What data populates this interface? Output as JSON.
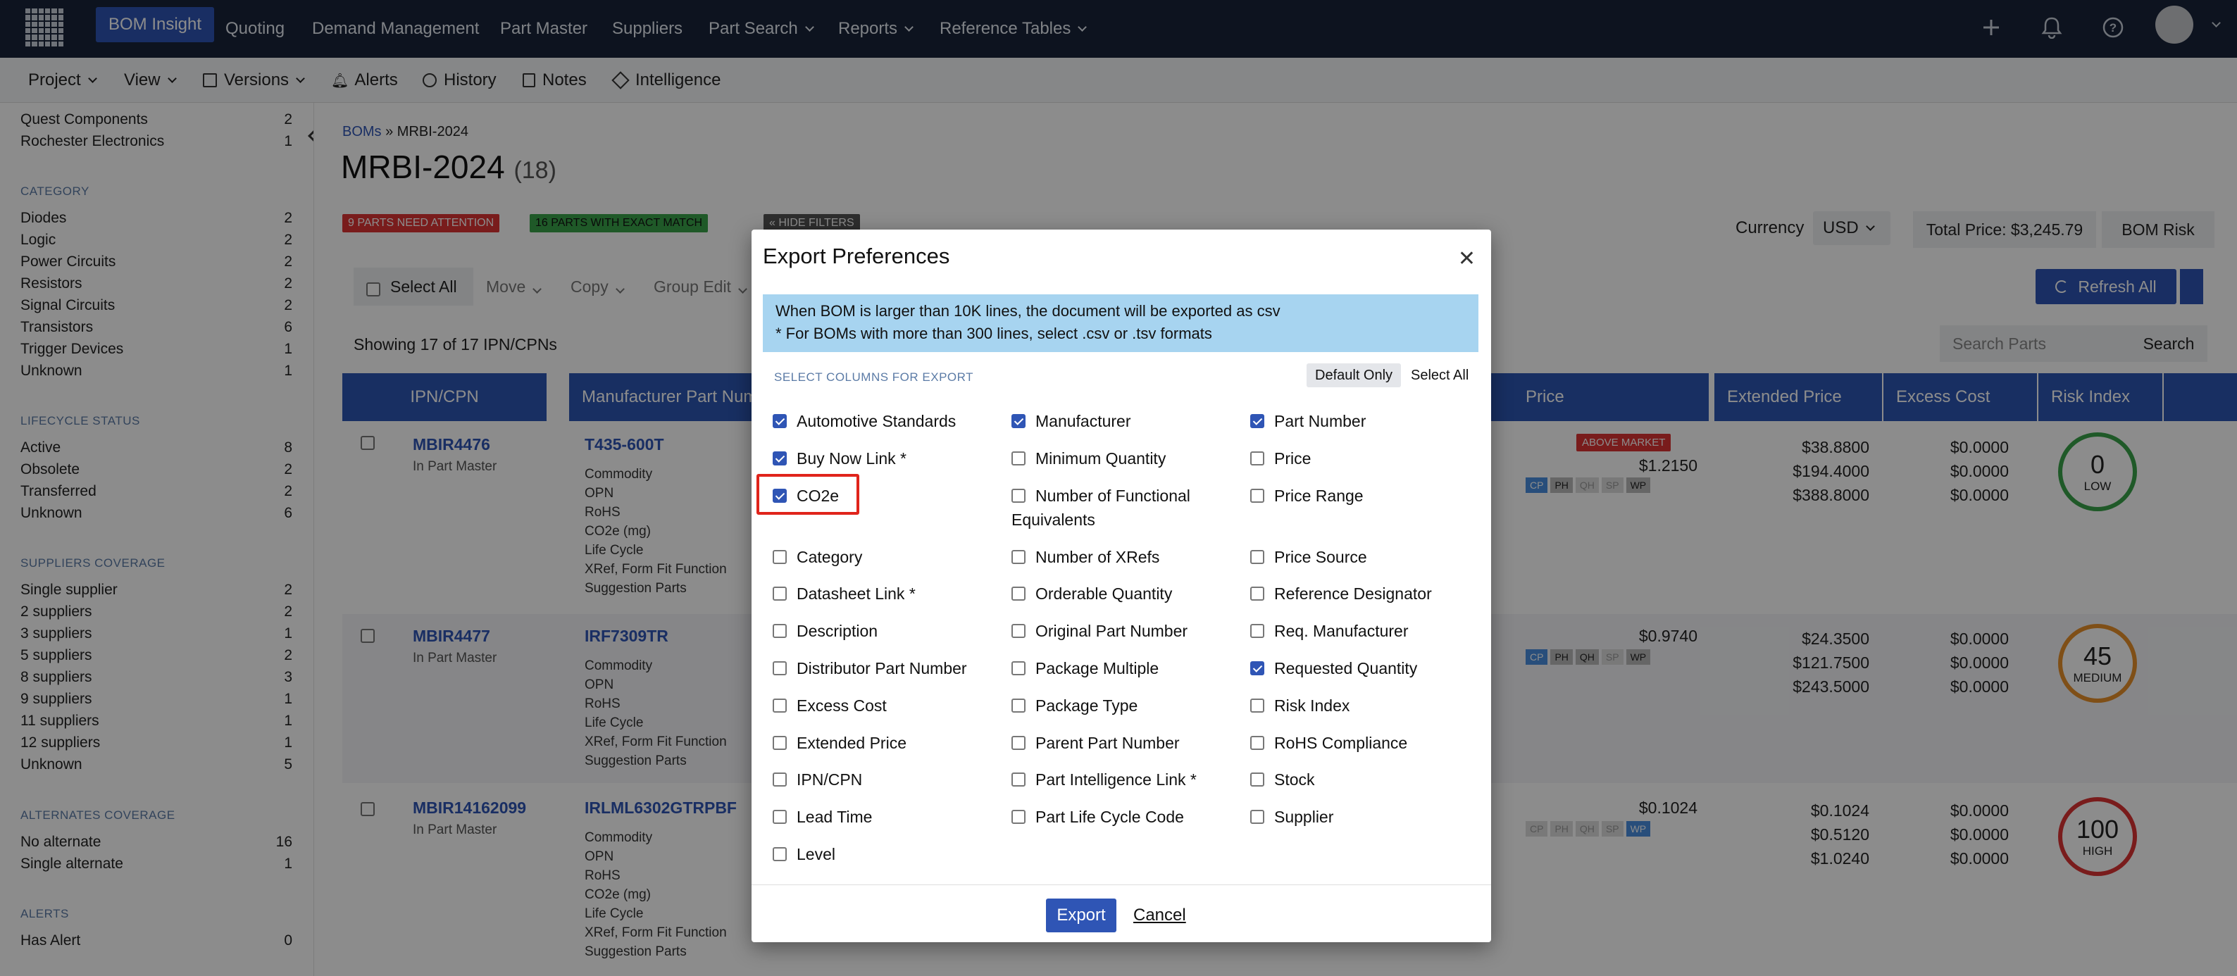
{
  "topnav": {
    "items": [
      "BOM Insight",
      "Quoting",
      "Demand Management",
      "Part Master",
      "Suppliers",
      "Part Search",
      "Reports",
      "Reference Tables"
    ],
    "icons": [
      "plus-icon",
      "bell-icon",
      "help-icon",
      "avatar"
    ]
  },
  "subnav": {
    "items": [
      "Project",
      "View",
      "Versions",
      "Alerts",
      "History",
      "Notes",
      "Intelligence"
    ]
  },
  "sidebar": {
    "top_rows": [
      {
        "label": "Quest Components",
        "count": "2"
      },
      {
        "label": "Rochester Electronics",
        "count": "1"
      }
    ],
    "sections": [
      {
        "title": "CATEGORY",
        "rows": [
          {
            "label": "Diodes",
            "count": "2"
          },
          {
            "label": "Logic",
            "count": "2"
          },
          {
            "label": "Power Circuits",
            "count": "2"
          },
          {
            "label": "Resistors",
            "count": "2"
          },
          {
            "label": "Signal Circuits",
            "count": "2"
          },
          {
            "label": "Transistors",
            "count": "6"
          },
          {
            "label": "Trigger Devices",
            "count": "1"
          },
          {
            "label": "Unknown",
            "count": "1"
          }
        ]
      },
      {
        "title": "LIFECYCLE STATUS",
        "rows": [
          {
            "label": "Active",
            "count": "8"
          },
          {
            "label": "Obsolete",
            "count": "2"
          },
          {
            "label": "Transferred",
            "count": "2"
          },
          {
            "label": "Unknown",
            "count": "6"
          }
        ]
      },
      {
        "title": "SUPPLIERS COVERAGE",
        "rows": [
          {
            "label": "Single supplier",
            "count": "2"
          },
          {
            "label": "2 suppliers",
            "count": "2"
          },
          {
            "label": "3 suppliers",
            "count": "1"
          },
          {
            "label": "5 suppliers",
            "count": "2"
          },
          {
            "label": "8 suppliers",
            "count": "3"
          },
          {
            "label": "9 suppliers",
            "count": "1"
          },
          {
            "label": "11 suppliers",
            "count": "1"
          },
          {
            "label": "12 suppliers",
            "count": "1"
          },
          {
            "label": "Unknown",
            "count": "5"
          }
        ]
      },
      {
        "title": "ALTERNATES COVERAGE",
        "rows": [
          {
            "label": "No alternate",
            "count": "16"
          },
          {
            "label": "Single alternate",
            "count": "1"
          }
        ]
      },
      {
        "title": "ALERTS",
        "rows": [
          {
            "label": "Has Alert",
            "count": "0"
          }
        ]
      }
    ]
  },
  "main": {
    "breadcrumb_link": "BOMs",
    "breadcrumb_current": "» MRBI-2024",
    "title": "MRBI-2024",
    "count": "(18)",
    "badge_attention": "9 PARTS NEED ATTENTION",
    "badge_match": "16 PARTS WITH EXACT MATCH",
    "hide_filters": "« HIDE FILTERS",
    "currency_label": "Currency",
    "currency_value": "USD",
    "total_price": "Total Price: $3,245.79",
    "bom_risk": "BOM Risk",
    "select_all": "Select All",
    "move": "Move",
    "copy": "Copy",
    "group_edit": "Group Edit",
    "refresh_all": "Refresh All",
    "showing": "Showing 17 of 17 IPN/CPNs",
    "search_placeholder": "Search Parts",
    "search_button": "Search",
    "columns": [
      "IPN/CPN",
      "Manufacturer Part Num",
      "Price",
      "Extended Price",
      "Excess Cost",
      "Risk Index"
    ],
    "rows": [
      {
        "ipn": "MBIR4476",
        "status": "In Part Master",
        "mpn": "T435-600T",
        "labels": [
          "Commodity",
          "OPN",
          "RoHS",
          "CO2e (mg)",
          "Life Cycle",
          "XRef, Form Fit Function",
          "Suggestion Parts"
        ],
        "price_badge": "ABOVE MARKET",
        "price": "$1.2150",
        "ext": [
          "$38.8800",
          "$194.4000",
          "$388.8000"
        ],
        "excess": [
          "$0.0000",
          "$0.0000",
          "$0.0000"
        ],
        "risk": "0",
        "risk_label": "LOW",
        "risk_color": "#3aa34a"
      },
      {
        "ipn": "MBIR4477",
        "status": "In Part Master",
        "mpn": "IRF7309TR",
        "labels": [
          "Commodity",
          "OPN",
          "RoHS",
          "Life Cycle",
          "XRef, Form Fit Function",
          "Suggestion Parts"
        ],
        "price_badge": "",
        "price": "$0.9740",
        "ext": [
          "$24.3500",
          "$121.7500",
          "$243.5000"
        ],
        "excess": [
          "$0.0000",
          "$0.0000",
          "$0.0000"
        ],
        "risk": "45",
        "risk_label": "MEDIUM",
        "risk_color": "#e8902a"
      },
      {
        "ipn": "MBIR14162099",
        "status": "In Part Master",
        "mpn": "IRLML6302GTRPBF",
        "labels": [
          "Commodity",
          "OPN",
          "RoHS",
          "CO2e (mg)",
          "Life Cycle",
          "XRef, Form Fit Function",
          "Suggestion Parts"
        ],
        "price_badge": "",
        "price": "$0.1024",
        "ext": [
          "$0.1024",
          "$0.5120",
          "$1.0240"
        ],
        "excess": [
          "$0.0000",
          "$0.0000",
          "$0.0000"
        ],
        "risk": "100",
        "risk_label": "HIGH",
        "risk_color": "#d33"
      }
    ],
    "supplier_tags": [
      "CP",
      "PH",
      "QH",
      "SP",
      "WP"
    ]
  },
  "modal": {
    "title": "Export Preferences",
    "info_line1": "When BOM is larger than 10K lines, the document will be exported as csv",
    "info_line2": "* For BOMs with more than 300 lines, select .csv or .tsv formats",
    "select_label": "SELECT COLUMNS FOR EXPORT",
    "default_only": "Default Only",
    "select_all": "Select All",
    "export": "Export",
    "cancel": "Cancel",
    "col1": [
      {
        "label": "Automotive Standards",
        "checked": true
      },
      {
        "label": "Buy Now Link *",
        "checked": true
      },
      {
        "label": "CO2e",
        "checked": true
      },
      {
        "label": "Category",
        "checked": false
      },
      {
        "label": "Datasheet Link *",
        "checked": false
      },
      {
        "label": "Description",
        "checked": false
      },
      {
        "label": "Distributor Part Number",
        "checked": false
      },
      {
        "label": "Excess Cost",
        "checked": false
      },
      {
        "label": "Extended Price",
        "checked": false
      },
      {
        "label": "IPN/CPN",
        "checked": false
      },
      {
        "label": "Lead Time",
        "checked": false
      },
      {
        "label": "Level",
        "checked": false
      }
    ],
    "col2": [
      {
        "label": "Manufacturer",
        "checked": true
      },
      {
        "label": "Minimum Quantity",
        "checked": false
      },
      {
        "label": "Number of Functional",
        "label2": "Equivalents",
        "checked": false
      },
      {
        "label": "Number of XRefs",
        "checked": false
      },
      {
        "label": "Orderable Quantity",
        "checked": false
      },
      {
        "label": "Original Part Number",
        "checked": false
      },
      {
        "label": "Package Multiple",
        "checked": false
      },
      {
        "label": "Package Type",
        "checked": false
      },
      {
        "label": "Parent Part Number",
        "checked": false
      },
      {
        "label": "Part Intelligence Link *",
        "checked": false
      },
      {
        "label": "Part Life Cycle Code",
        "checked": false
      }
    ],
    "col3": [
      {
        "label": "Part Number",
        "checked": true
      },
      {
        "label": "Price",
        "checked": false
      },
      {
        "label": "Price Range",
        "checked": false
      },
      {
        "label": "Price Source",
        "checked": false
      },
      {
        "label": "Reference Designator",
        "checked": false
      },
      {
        "label": "Req. Manufacturer",
        "checked": false
      },
      {
        "label": "Requested Quantity",
        "checked": true
      },
      {
        "label": "Risk Index",
        "checked": false
      },
      {
        "label": "RoHS Compliance",
        "checked": false
      },
      {
        "label": "Stock",
        "checked": false
      },
      {
        "label": "Supplier",
        "checked": false
      }
    ]
  }
}
